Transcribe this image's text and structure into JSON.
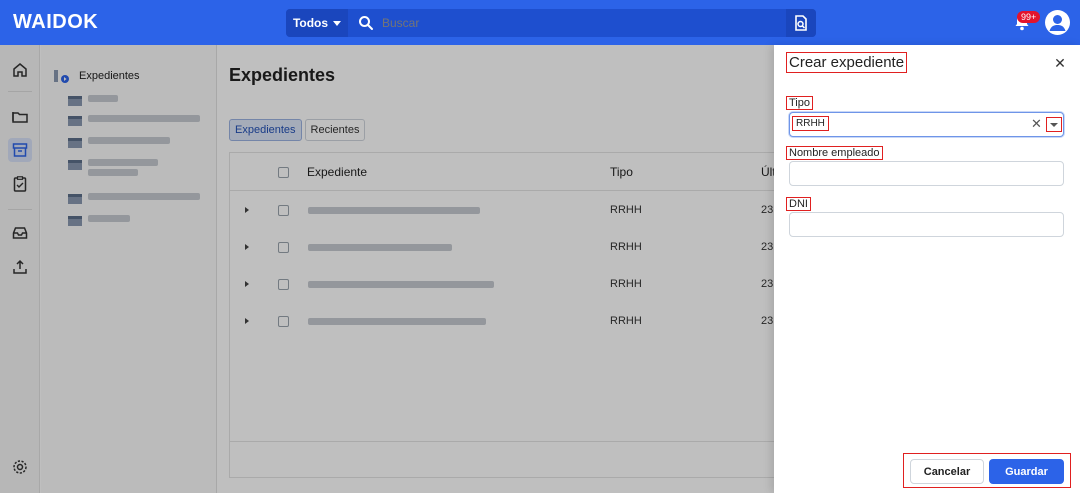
{
  "header": {
    "logo": "WAIDOK",
    "search_scope": "Todos",
    "search_placeholder": "Buscar",
    "notifications_badge": "99+"
  },
  "tree": {
    "root_label": "Expedientes"
  },
  "main": {
    "title": "Expedientes",
    "tabs": [
      {
        "label": "Expedientes",
        "active": true
      },
      {
        "label": "Recientes",
        "active": false
      }
    ],
    "table": {
      "columns": [
        "Expediente",
        "Tipo",
        "Últ"
      ],
      "rows": [
        {
          "tipo": "RRHH",
          "fecha": "23,"
        },
        {
          "tipo": "RRHH",
          "fecha": "23,"
        },
        {
          "tipo": "RRHH",
          "fecha": "23,"
        },
        {
          "tipo": "RRHH",
          "fecha": "23,"
        }
      ]
    }
  },
  "drawer": {
    "title": "Crear expediente",
    "fields": {
      "tipo": {
        "label": "Tipo",
        "value": "RRHH"
      },
      "nombre": {
        "label": "Nombre empleado",
        "value": ""
      },
      "dni": {
        "label": "DNI",
        "value": ""
      }
    },
    "cancel_label": "Cancelar",
    "save_label": "Guardar"
  },
  "colors": {
    "brand": "#2c63e8",
    "highlight": "#e02020",
    "badge": "#e3132c"
  }
}
